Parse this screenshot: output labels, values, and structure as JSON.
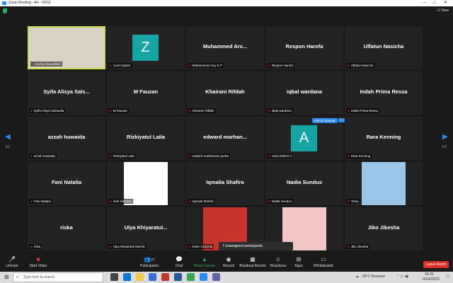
{
  "window": {
    "title": "Zoom Meeting - A4 - VRS2"
  },
  "tiles": [
    {
      "name": "",
      "label": "Kurnia Ramadhan",
      "kind": "video",
      "active": true
    },
    {
      "name": "",
      "label": "zoom baa04",
      "kind": "avatar",
      "letter": "Z",
      "color": "#16a5a4"
    },
    {
      "name": "Muhammed  Ars...",
      "label": "Muhammed Arsy E P",
      "kind": "name"
    },
    {
      "name": "Respon Harefa",
      "label": "Respon Harefa",
      "kind": "name"
    },
    {
      "name": "Ulfatun Nasicha",
      "label": "Ulfatun Nasicha",
      "kind": "name"
    },
    {
      "name": "Syifa  Alisya  Sals...",
      "label": "Syifa Alisya Salsadila",
      "kind": "name"
    },
    {
      "name": "M Fauzan",
      "label": "M Fauzan",
      "kind": "name"
    },
    {
      "name": "Khairani Rifdah",
      "label": "Khairani Rifdah",
      "kind": "name"
    },
    {
      "name": "iqbal wardana",
      "label": "iqbal wardana",
      "kind": "name"
    },
    {
      "name": "Indah Prima Ressa",
      "label": "Indah Prima Ressa",
      "kind": "name"
    },
    {
      "name": "azzah huwaida",
      "label": "azzah huwaida",
      "kind": "name"
    },
    {
      "name": "Rizkiyatul Laila",
      "label": "Rizkiyatul Laila",
      "kind": "name"
    },
    {
      "name": "edward  marhan...",
      "label": "edward marhannes purba",
      "kind": "name"
    },
    {
      "name": "",
      "label": "Aulia Rahmi H",
      "kind": "avatar",
      "letter": "A",
      "color": "#16a5a4"
    },
    {
      "name": "Rara Kenning",
      "label": "Rara Kenning",
      "kind": "name"
    },
    {
      "name": "Fani Natalia",
      "label": "Fani Natalia",
      "kind": "name"
    },
    {
      "name": "",
      "label": "indri islamiati",
      "kind": "video"
    },
    {
      "name": "Iqmalia Shafira",
      "label": "Iqmalia Shafira",
      "kind": "name"
    },
    {
      "name": "Nadia Sundus",
      "label": "Nadia Sundus",
      "kind": "name"
    },
    {
      "name": "",
      "label": "Tomy",
      "kind": "video"
    },
    {
      "name": "riska",
      "label": "riska",
      "kind": "name"
    },
    {
      "name": "Ulya  Khiyaratul...",
      "label": "Ulya Khiyaratul Mar'ah",
      "kind": "name"
    },
    {
      "name": "",
      "label": "Ester Graciela",
      "kind": "video"
    },
    {
      "name": "",
      "label": "",
      "kind": "video"
    },
    {
      "name": "Jiko Jikesha",
      "label": "Jiko Jikesha",
      "kind": "name"
    }
  ],
  "overlay": {
    "ask_unmute": "Ask to Unmute",
    "more": "···",
    "unassigned": "7 unassigned participants"
  },
  "paging": {
    "left": "1/2",
    "right": "1/2"
  },
  "toolbar": {
    "unmute": "Unmute",
    "start_video": "Start Video",
    "participants": "Participants",
    "participants_count": "27",
    "chat": "Chat",
    "share_screen": "Share Screen",
    "record": "Record",
    "breakout": "Breakout Rooms",
    "reactions": "Reactions",
    "apps": "Apps",
    "whiteboards": "Whiteboards",
    "leave": "Leave Room"
  },
  "taskbar": {
    "search_placeholder": "Type here to search",
    "weather": "26°C  Berawan",
    "time": "18:35",
    "date": "10/24/2022"
  },
  "colors": {
    "accent": "#2d8cff",
    "active_border": "#c8e04a",
    "leave": "#d93025",
    "share": "#27b35c"
  }
}
